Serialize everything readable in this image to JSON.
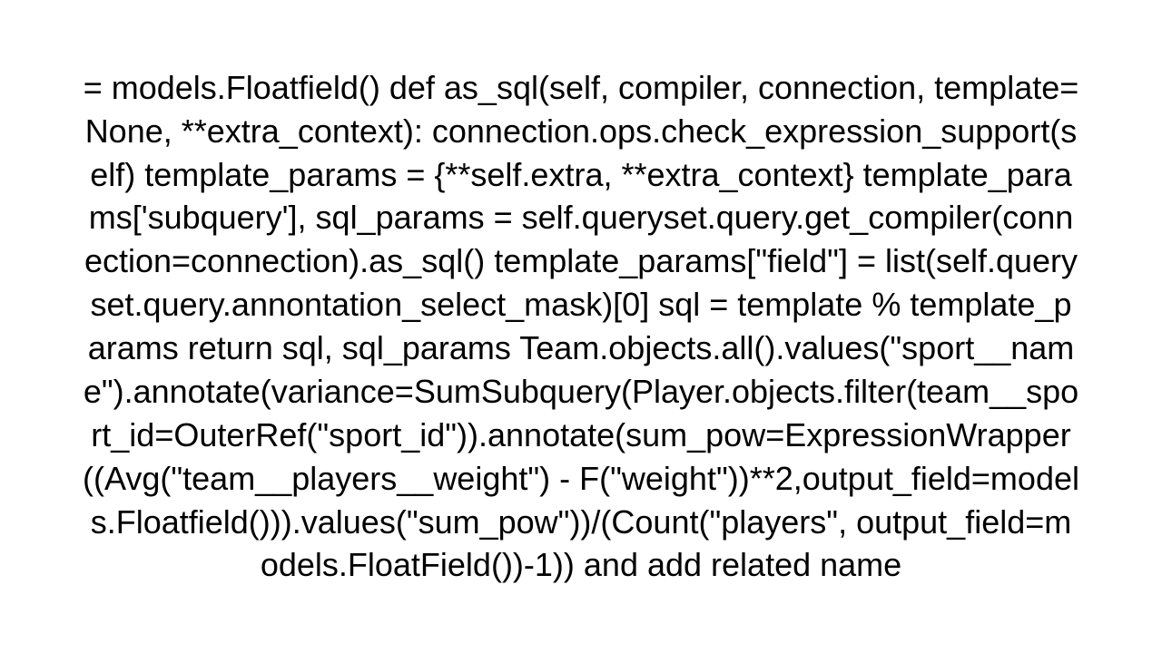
{
  "text": "= models.Floatfield()     def as_sql(self, compiler, connection, template=None, **extra_context):         connection.ops.check_expression_support(self)         template_params = {**self.extra, **extra_context}         template_params['subquery'], sql_params = self.queryset.query.get_compiler(connection=connection).as_sql()         template_params[\"field\"] = list(self.queryset.query.annontation_select_mask)[0]         sql = template % template_params          return sql, sql_params    Team.objects.all().values(\"sport__name\").annotate(variance=SumSubquery(Player.objects.filter(team__sport_id=OuterRef(\"sport_id\")).annotate(sum_pow=ExpressionWrapper((Avg(\"team__players__weight\") - F(\"weight\"))**2,output_field=models.Floatfield())).values(\"sum_pow\"))/(Count(\"players\", output_field=models.FloatField())-1))  and add related name"
}
